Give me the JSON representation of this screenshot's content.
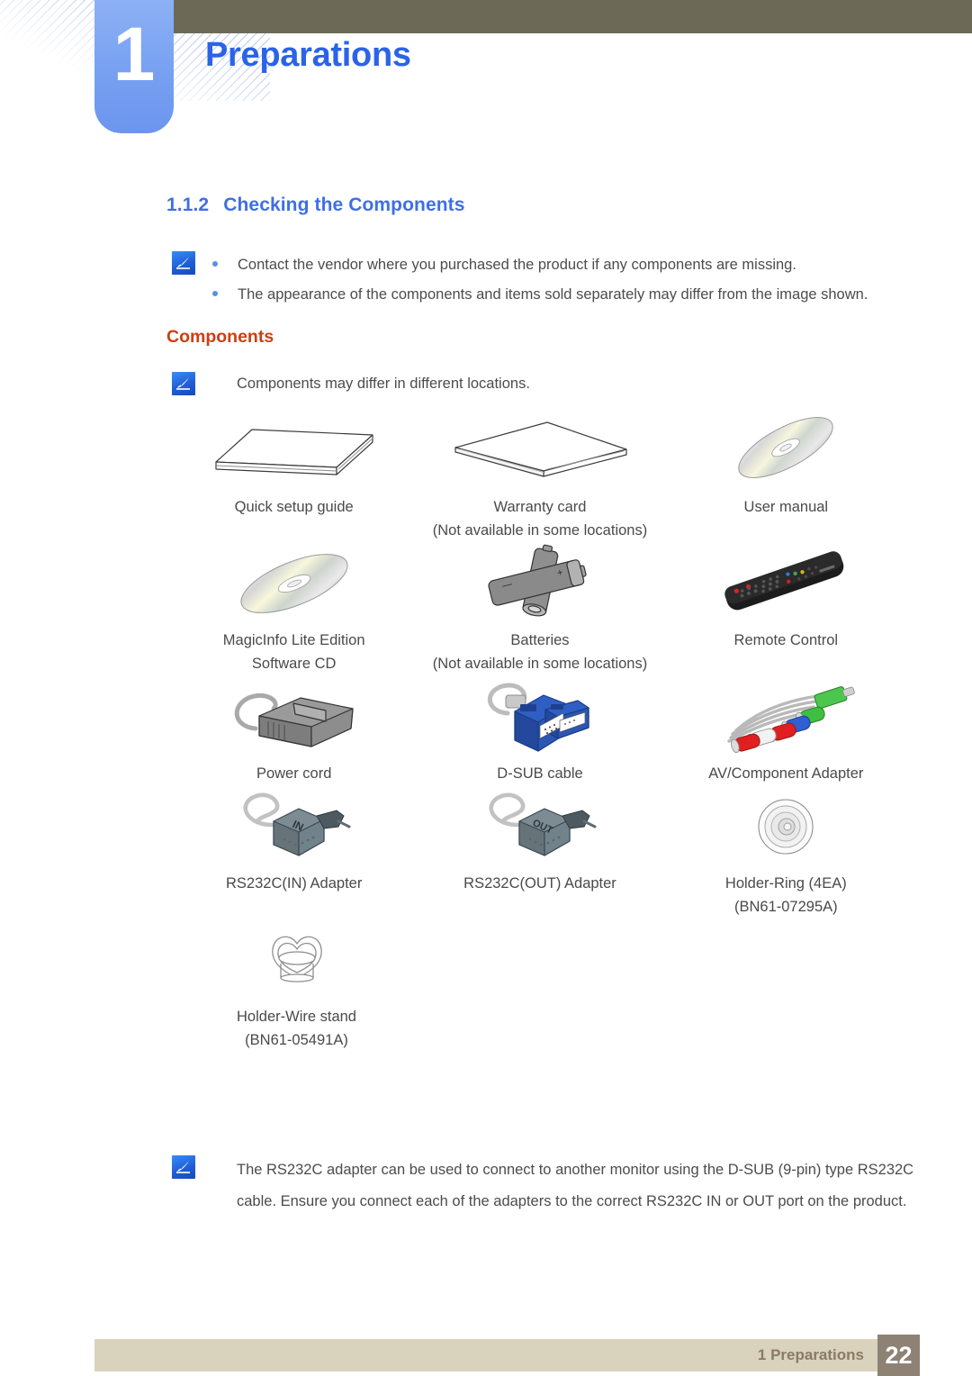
{
  "header": {
    "chapter_number": "1",
    "chapter_title": "Preparations"
  },
  "section": {
    "number": "1.1.2",
    "title": "Checking the Components"
  },
  "top_note": {
    "icon": "note-pencil-icon",
    "bullets": [
      "Contact the vendor where you purchased the product if any components are missing.",
      "The appearance of the components and items sold separately may differ from the image shown."
    ]
  },
  "components_heading": "Components",
  "components_note": {
    "icon": "note-pencil-icon",
    "text": "Components may differ in different locations."
  },
  "components": [
    [
      {
        "icon": "booklet-icon",
        "line1": "Quick setup guide",
        "line2": ""
      },
      {
        "icon": "paper-stack-icon",
        "line1": "Warranty card",
        "line2": "(Not available in some locations)"
      },
      {
        "icon": "cd-disc-icon",
        "line1": "User manual",
        "line2": ""
      }
    ],
    [
      {
        "icon": "cd-disc-icon",
        "line1": "MagicInfo Lite Edition",
        "line2": "Software CD"
      },
      {
        "icon": "batteries-icon",
        "line1": "Batteries",
        "line2": "(Not available in some locations)"
      },
      {
        "icon": "remote-control-icon",
        "line1": "Remote Control",
        "line2": ""
      }
    ],
    [
      {
        "icon": "power-cord-icon",
        "line1": "Power cord",
        "line2": ""
      },
      {
        "icon": "dsub-cable-icon",
        "line1": "D-SUB cable",
        "line2": ""
      },
      {
        "icon": "av-component-adapter-icon",
        "line1": "AV/Component Adapter",
        "line2": ""
      }
    ],
    [
      {
        "icon": "rs232c-in-adapter-icon",
        "line1": "RS232C(IN) Adapter",
        "line2": ""
      },
      {
        "icon": "rs232c-out-adapter-icon",
        "line1": "RS232C(OUT) Adapter",
        "line2": ""
      },
      {
        "icon": "holder-ring-icon",
        "line1": "Holder-Ring (4EA)",
        "line2": "(BN61-07295A)"
      }
    ],
    [
      {
        "icon": "holder-wire-stand-icon",
        "line1": "Holder-Wire stand",
        "line2": "(BN61-05491A)"
      }
    ]
  ],
  "bottom_note": {
    "icon": "note-pencil-icon",
    "line1": "The RS232C adapter can be used to connect to another monitor using the D-SUB (9-pin) type RS232C",
    "line2": "cable. Ensure you connect each of the adapters to the correct RS232C IN or OUT port on the product."
  },
  "footer": {
    "label": "1 Preparations",
    "page_number": "22"
  },
  "colors": {
    "chapter_tab": "#7aa3f2",
    "olive_bar": "#6c6a57",
    "heading_blue": "#3f6fe5",
    "components_orange": "#cc3f12",
    "footer_bar": "#d9d2bd",
    "footer_text": "#8a7a66",
    "page_box": "#8d8274"
  }
}
